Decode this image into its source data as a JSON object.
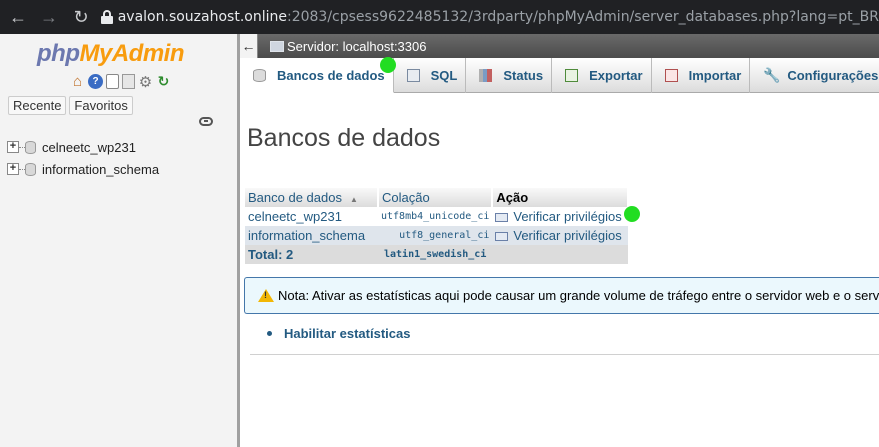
{
  "browser": {
    "url_host": "avalon.souzahost.online",
    "url_path": ":2083/cpsess9622485132/3rdparty/phpMyAdmin/server_databases.php?lang=pt_BR"
  },
  "nav": {
    "logo_php": "php",
    "logo_admin": "MyAdmin",
    "icons": [
      "home-icon",
      "help-icon",
      "docs-icon",
      "sql-docs-icon",
      "settings-gear-icon",
      "reload-icon"
    ],
    "tabs": [
      "Recente",
      "Favoritos"
    ],
    "databases": [
      "celneetc_wp231",
      "information_schema"
    ]
  },
  "server": {
    "label": "Servidor: localhost:3306"
  },
  "tabs": [
    "Bancos de dados",
    "SQL",
    "Status",
    "Exportar",
    "Importar",
    "Configurações"
  ],
  "page": {
    "title": "Bancos de dados"
  },
  "table": {
    "headers": [
      "Banco de dados",
      "Colação",
      "Ação"
    ],
    "rows": [
      {
        "name": "celneetc_wp231",
        "collation": "utf8mb4_unicode_ci",
        "action": "Verificar privilégios"
      },
      {
        "name": "information_schema",
        "collation": "utf8_general_ci",
        "action": "Verificar privilégios"
      }
    ],
    "total_label": "Total: 2",
    "total_collation": "latin1_swedish_ci"
  },
  "notice": {
    "text": "Nota: Ativar as estatísticas aqui pode causar um grande volume de tráfego entre o servidor web e o servidor MySQL."
  },
  "stats": {
    "link": "Habilitar estatísticas"
  },
  "colors": {
    "link": "#235a81",
    "accent_php": "#6c78af",
    "accent_admin": "#f89c0e",
    "marker": "#22dd22"
  }
}
